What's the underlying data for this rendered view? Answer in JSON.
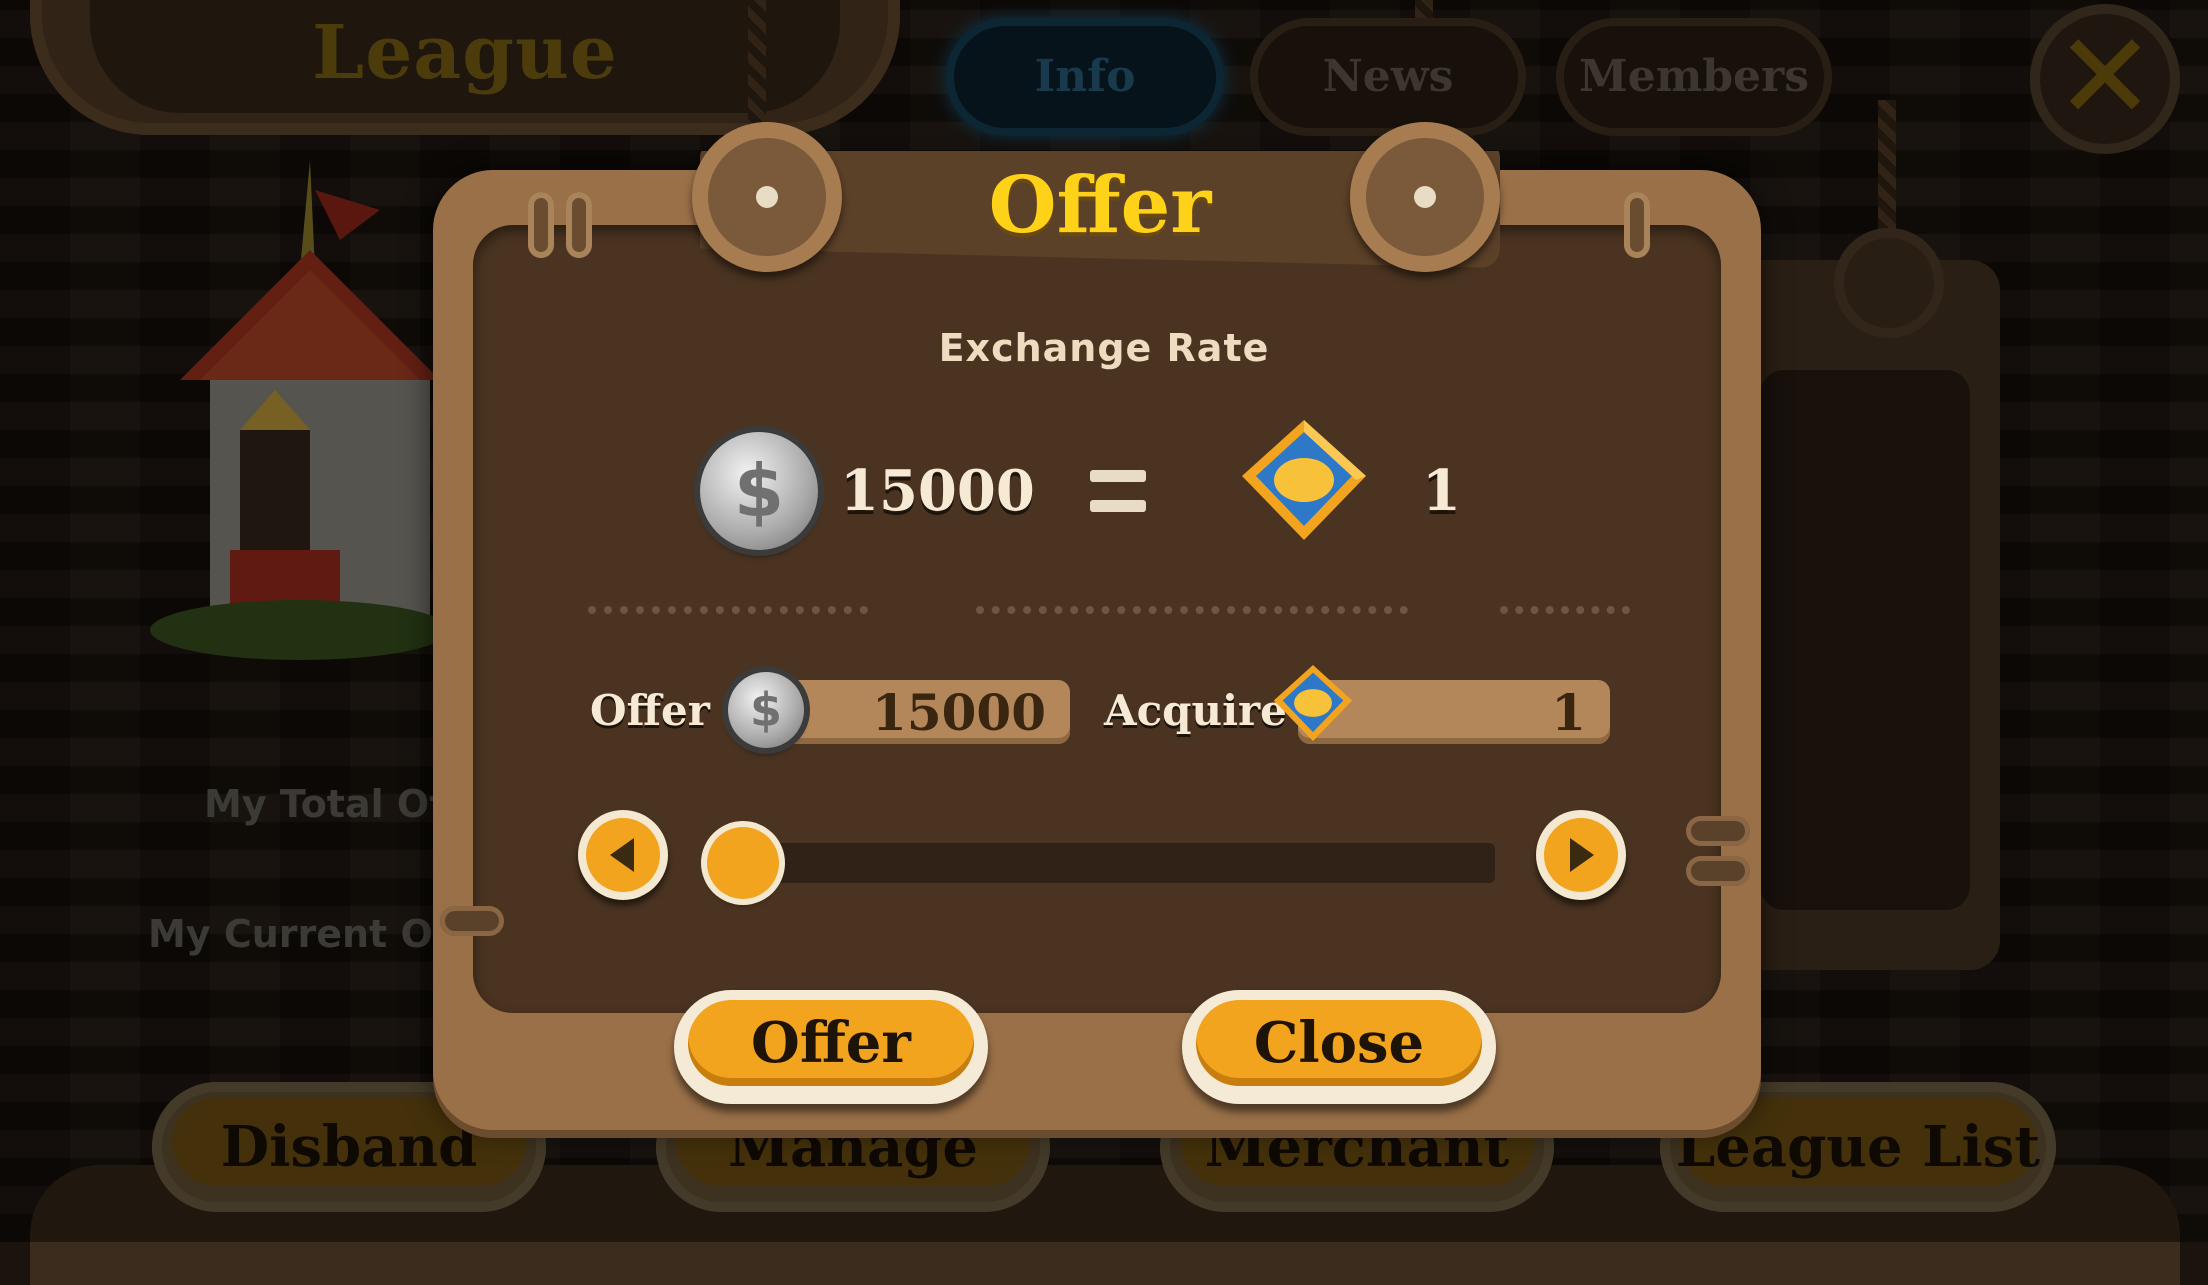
{
  "header": {
    "league_title": "League",
    "tabs": [
      {
        "label": "Info",
        "active": true
      },
      {
        "label": "News",
        "active": false
      },
      {
        "label": "Members",
        "active": false
      }
    ],
    "close_icon": "close-x-icon"
  },
  "background": {
    "side_labels": [
      "My Total Of",
      "My Current Of"
    ],
    "bottom_buttons": [
      "Disband",
      "Manage",
      "Merchant",
      "League List"
    ]
  },
  "dialog": {
    "title": "Offer",
    "exchange_rate_label": "Exchange Rate",
    "rate_coin_amount": "15000",
    "rate_badge_amount": "1",
    "offer_label": "Offer",
    "offer_value": "15000",
    "acquire_label": "Acquire",
    "acquire_value": "1",
    "slider_level": 0.0,
    "offer_button": "Offer",
    "close_button": "Close"
  },
  "colors": {
    "accent_orange": "#f2a41e",
    "title_yellow": "#ffd21a",
    "slider_fill": "#2fa8b0",
    "panel_brown": "#4a3320"
  }
}
